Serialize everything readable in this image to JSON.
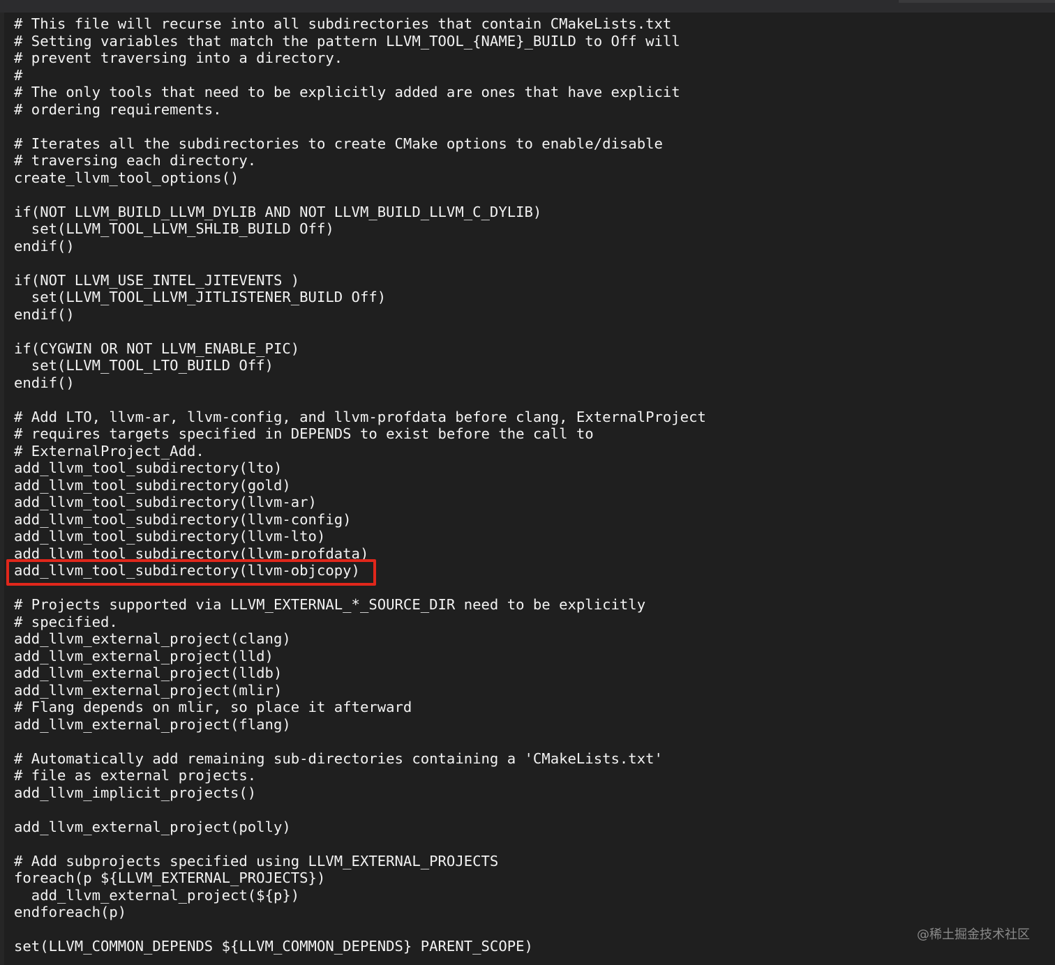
{
  "editor": {
    "lines": [
      "# This file will recurse into all subdirectories that contain CMakeLists.txt",
      "# Setting variables that match the pattern LLVM_TOOL_{NAME}_BUILD to Off will",
      "# prevent traversing into a directory.",
      "#",
      "# The only tools that need to be explicitly added are ones that have explicit",
      "# ordering requirements.",
      "",
      "# Iterates all the subdirectories to create CMake options to enable/disable",
      "# traversing each directory.",
      "create_llvm_tool_options()",
      "",
      "if(NOT LLVM_BUILD_LLVM_DYLIB AND NOT LLVM_BUILD_LLVM_C_DYLIB)",
      "  set(LLVM_TOOL_LLVM_SHLIB_BUILD Off)",
      "endif()",
      "",
      "if(NOT LLVM_USE_INTEL_JITEVENTS )",
      "  set(LLVM_TOOL_LLVM_JITLISTENER_BUILD Off)",
      "endif()",
      "",
      "if(CYGWIN OR NOT LLVM_ENABLE_PIC)",
      "  set(LLVM_TOOL_LTO_BUILD Off)",
      "endif()",
      "",
      "# Add LTO, llvm-ar, llvm-config, and llvm-profdata before clang, ExternalProject",
      "# requires targets specified in DEPENDS to exist before the call to",
      "# ExternalProject_Add.",
      "add_llvm_tool_subdirectory(lto)",
      "add_llvm_tool_subdirectory(gold)",
      "add_llvm_tool_subdirectory(llvm-ar)",
      "add_llvm_tool_subdirectory(llvm-config)",
      "add_llvm_tool_subdirectory(llvm-lto)",
      "add_llvm_tool_subdirectory(llvm-profdata)",
      "add_llvm_tool_subdirectory(llvm-objcopy)",
      "",
      "# Projects supported via LLVM_EXTERNAL_*_SOURCE_DIR need to be explicitly",
      "# specified.",
      "add_llvm_external_project(clang)",
      "add_llvm_external_project(lld)",
      "add_llvm_external_project(lldb)",
      "add_llvm_external_project(mlir)",
      "# Flang depends on mlir, so place it afterward",
      "add_llvm_external_project(flang)",
      "",
      "# Automatically add remaining sub-directories containing a 'CMakeLists.txt'",
      "# file as external projects.",
      "add_llvm_implicit_projects()",
      "",
      "add_llvm_external_project(polly)",
      "",
      "# Add subprojects specified using LLVM_EXTERNAL_PROJECTS",
      "foreach(p ${LLVM_EXTERNAL_PROJECTS})",
      "  add_llvm_external_project(${p})",
      "endforeach(p)",
      "",
      "set(LLVM_COMMON_DEPENDS ${LLVM_COMMON_DEPENDS} PARENT_SCOPE)"
    ],
    "highlight": {
      "line_number": 33,
      "color": "#e0271b"
    }
  },
  "watermark": "@稀土掘金技术社区",
  "colors": {
    "background": "#1f1f1f",
    "text": "#f2f2f2",
    "highlight_border": "#e0271b",
    "watermark": "#8a8a8a"
  }
}
